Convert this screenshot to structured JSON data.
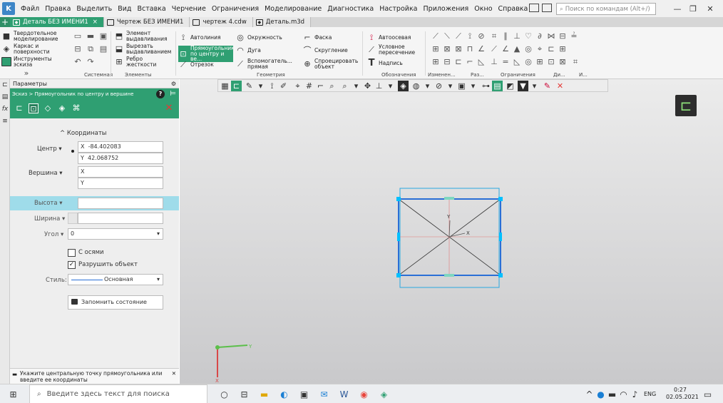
{
  "menubar": {
    "items": [
      "Файл",
      "Правка",
      "Выделить",
      "Вид",
      "Вставка",
      "Черчение",
      "Ограничения",
      "Моделирование",
      "Диагностика",
      "Настройка",
      "Приложения",
      "Окно",
      "Справка"
    ],
    "search_placeholder": "Поиск по командам (Alt+/)"
  },
  "tabs": [
    {
      "label": "Деталь БЕЗ ИМЕНИ1",
      "active": true,
      "close": "×"
    },
    {
      "label": "Чертеж БЕЗ ИМЕНИ1",
      "active": false
    },
    {
      "label": "чертеж 4.cdw",
      "active": false
    },
    {
      "label": "Деталь.m3d",
      "active": false
    }
  ],
  "ribbon": {
    "modes": {
      "solid": "Твердотельное моделирование",
      "wire": "Каркас и поверхности",
      "sketch_tools": "Инструменты эскиза"
    },
    "elements": {
      "extrude": "Элемент выдавливания",
      "cut": "Вырезать выдавливанием",
      "rib": "Ребро жесткости"
    },
    "geometry": {
      "autoline": "Автолиния",
      "rect": "Прямоугольник по центру и ве...",
      "segment": "Отрезок",
      "circle": "Окружность",
      "arc": "Дуга",
      "aux": "Вспомогатель... прямая",
      "chamfer": "Фаска",
      "fillet": "Скругление",
      "project": "Спроецировать объект"
    },
    "annotations": {
      "axis": "Автоосевая",
      "cond": "Условное пересечение",
      "text": "Надпись"
    },
    "group_labels": [
      "Системная",
      "Элементы",
      "Геометрия",
      "Обозначения",
      "Изменен...",
      "Раз...",
      "Ограничения",
      "Ди...",
      "И..."
    ]
  },
  "panel": {
    "title": "Параметры",
    "breadcrumb": "Эскиз > Прямоугольник по центру и вершине",
    "section": "Координаты",
    "center_label": "Центр",
    "center_x": "-84.402083",
    "center_y": "42.068752",
    "vertex_label": "Вершина",
    "axis_x": "X",
    "axis_y": "Y",
    "height_label": "Высота",
    "width_label": "Ширина",
    "angle_label": "Угол",
    "angle_value": "0",
    "with_axes": "С осями",
    "with_axes_checked": false,
    "destroy": "Разрушить объект",
    "destroy_checked": true,
    "style_label": "Стиль:",
    "style_value": "Основная",
    "remember": "Запомнить состояние",
    "hint": "Укажите центральную точку прямоугольника или введите ее координаты"
  },
  "canvas": {
    "axis_x": "X",
    "axis_y": "Y"
  },
  "taskbar": {
    "search_placeholder": "Введите здесь текст для поиска",
    "lang": "ENG",
    "time": "0:27",
    "date": "02.05.2021"
  },
  "colors": {
    "accent": "#2f9f72",
    "selection": "#00c0ff",
    "sketch": "#2a6fd6"
  }
}
